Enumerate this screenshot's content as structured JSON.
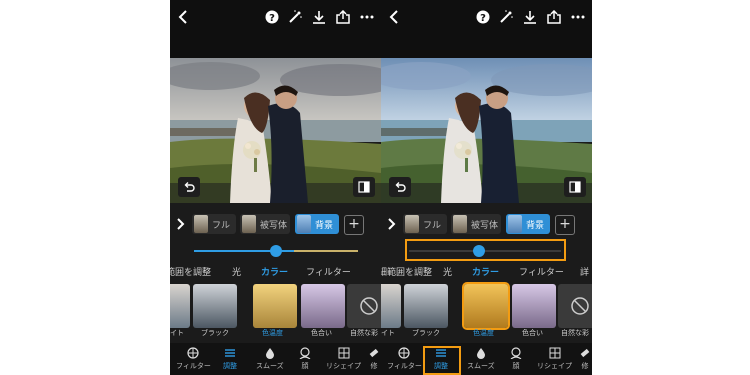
{
  "colors": {
    "accent": "#2f9de5",
    "highlight": "#f39c12",
    "panel": "#1b1b1b"
  },
  "toolbar_icons": [
    "back-icon",
    "help-icon",
    "magic-wand-icon",
    "download-icon",
    "share-icon",
    "more-icon"
  ],
  "mask_modes": {
    "full": "フル",
    "subject": "被写体",
    "background": "背景"
  },
  "left": {
    "tabs": [
      "範囲を調整",
      "光",
      "カラー",
      "フィルター"
    ],
    "filters": [
      "イト",
      "ブラック",
      "色温度",
      "色合い",
      "自然な彩"
    ]
  },
  "right": {
    "tabs": [
      "詳細範囲を調整",
      "光",
      "カラー",
      "フィルター",
      "詳"
    ],
    "filters": [
      "イト",
      "ブラック",
      "色温度",
      "色合い",
      "自然な彩"
    ]
  },
  "nav_left": [
    "フィルター",
    "調整",
    "スムーズ",
    "顔",
    "リシェイプ",
    "修"
  ],
  "nav_right": [
    "フィルター",
    "調整",
    "スムーズ",
    "顔",
    "リシェイプ",
    "修"
  ],
  "slider_left": 0.5,
  "slider_right": 0.46
}
